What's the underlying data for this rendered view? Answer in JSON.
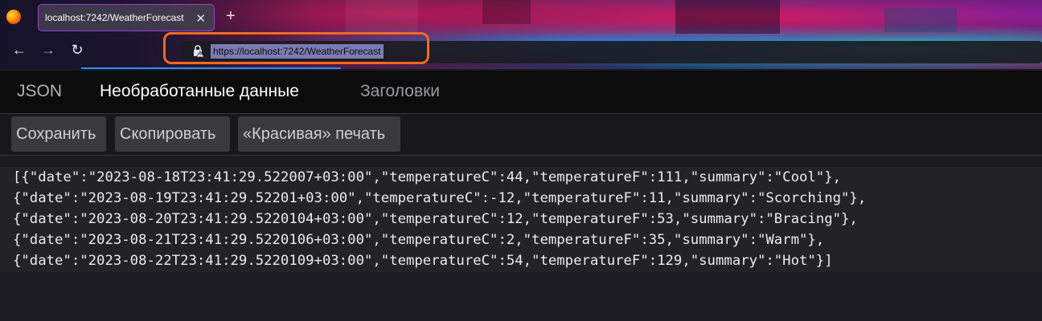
{
  "browser": {
    "tab_title": "localhost:7242/WeatherForecast",
    "tab_close": "✕",
    "new_tab": "+",
    "url": "https://localhost:7242/WeatherForecast",
    "back": "←",
    "forward": "→",
    "reload": "↻",
    "highlight_color": "#f26a21"
  },
  "viewer": {
    "tabs": [
      {
        "label": "JSON"
      },
      {
        "label": "Необработанные данные"
      },
      {
        "label": "Заголовки"
      }
    ],
    "active_tab": "Необработанные данные",
    "toolbar": {
      "save": "Сохранить",
      "copy": "Скопировать",
      "pretty": "«Красивая» печать"
    },
    "raw_lines": [
      "[{\"date\":\"2023-08-18T23:41:29.522007+03:00\",\"temperatureC\":44,\"temperatureF\":111,\"summary\":\"Cool\"},",
      "{\"date\":\"2023-08-19T23:41:29.52201+03:00\",\"temperatureC\":-12,\"temperatureF\":11,\"summary\":\"Scorching\"},",
      "{\"date\":\"2023-08-20T23:41:29.5220104+03:00\",\"temperatureC\":12,\"temperatureF\":53,\"summary\":\"Bracing\"},",
      "{\"date\":\"2023-08-21T23:41:29.5220106+03:00\",\"temperatureC\":2,\"temperatureF\":35,\"summary\":\"Warm\"},",
      "{\"date\":\"2023-08-22T23:41:29.5220109+03:00\",\"temperatureC\":54,\"temperatureF\":129,\"summary\":\"Hot\"}]"
    ]
  }
}
